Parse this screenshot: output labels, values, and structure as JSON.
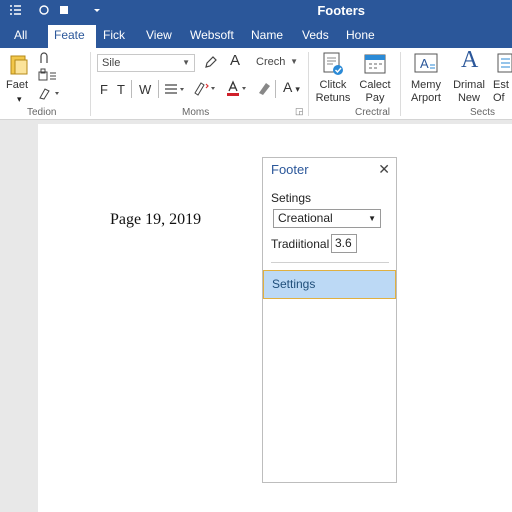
{
  "titlebar": {
    "title": "Footers",
    "quick_access": [
      "list-icon",
      "circle-icon",
      "square-icon",
      "dropdown-icon"
    ]
  },
  "tabs": [
    "All",
    "Feate",
    "Fick",
    "View",
    "Websoft",
    "Name",
    "Veds",
    "Hone"
  ],
  "active_tab": "Feate",
  "ribbon": {
    "group1": {
      "label": "Tedion",
      "big_button": "Faet",
      "icons": [
        "folder-icon",
        "paste-icon",
        "clipboard-icon",
        "brush-icon"
      ]
    },
    "group2": {
      "label": "Moms",
      "font_box": "Sile",
      "style_box": "Crech",
      "row2": [
        "F",
        "T",
        "W"
      ]
    },
    "group3": {
      "label": "Crectral",
      "buttons": [
        "Clitck\nRetuns",
        "Calect\nPay"
      ]
    },
    "group4": {
      "label": "Sects",
      "buttons": [
        "Memy\nArport",
        "Drimal\nNew",
        "Est\nOf"
      ]
    }
  },
  "document": {
    "text": "Page 19, 2019"
  },
  "pane": {
    "title": "Footer",
    "settings_label": "Setings",
    "dropdown_value": "Creational",
    "traditional_label": "Tradiitional",
    "traditional_value": "3.6",
    "selected_item": "Settings"
  },
  "colors": {
    "brand": "#2b579a",
    "selection": "#bcd9f5",
    "selection_border": "#e0b040"
  }
}
